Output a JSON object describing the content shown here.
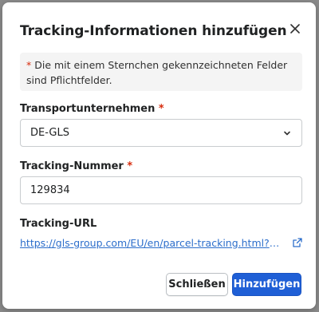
{
  "dialog": {
    "title": "Tracking-Informationen hinzufügen",
    "close_icon": "close-icon"
  },
  "notice": {
    "asterisk": "*",
    "text": " Die mit einem Sternchen gekennzeichneten Felder sind Pflichtfelder."
  },
  "carrier": {
    "label": "Transportunternehmen",
    "required_mark": "*",
    "value": "DE-GLS",
    "icon": "chevron-down-icon"
  },
  "tracking_number": {
    "label": "Tracking-Nummer",
    "required_mark": "*",
    "value": "129834"
  },
  "tracking_url": {
    "label": "Tracking-URL",
    "value": "https://gls-group.com/EU/en/parcel-tracking.html?match…",
    "icon": "external-link-icon"
  },
  "buttons": {
    "close_label": "Schließen",
    "add_label": "Hinzufügen"
  },
  "colors": {
    "primary": "#1f5fd6",
    "required": "#d72c0d",
    "link": "#2c6ecb"
  }
}
